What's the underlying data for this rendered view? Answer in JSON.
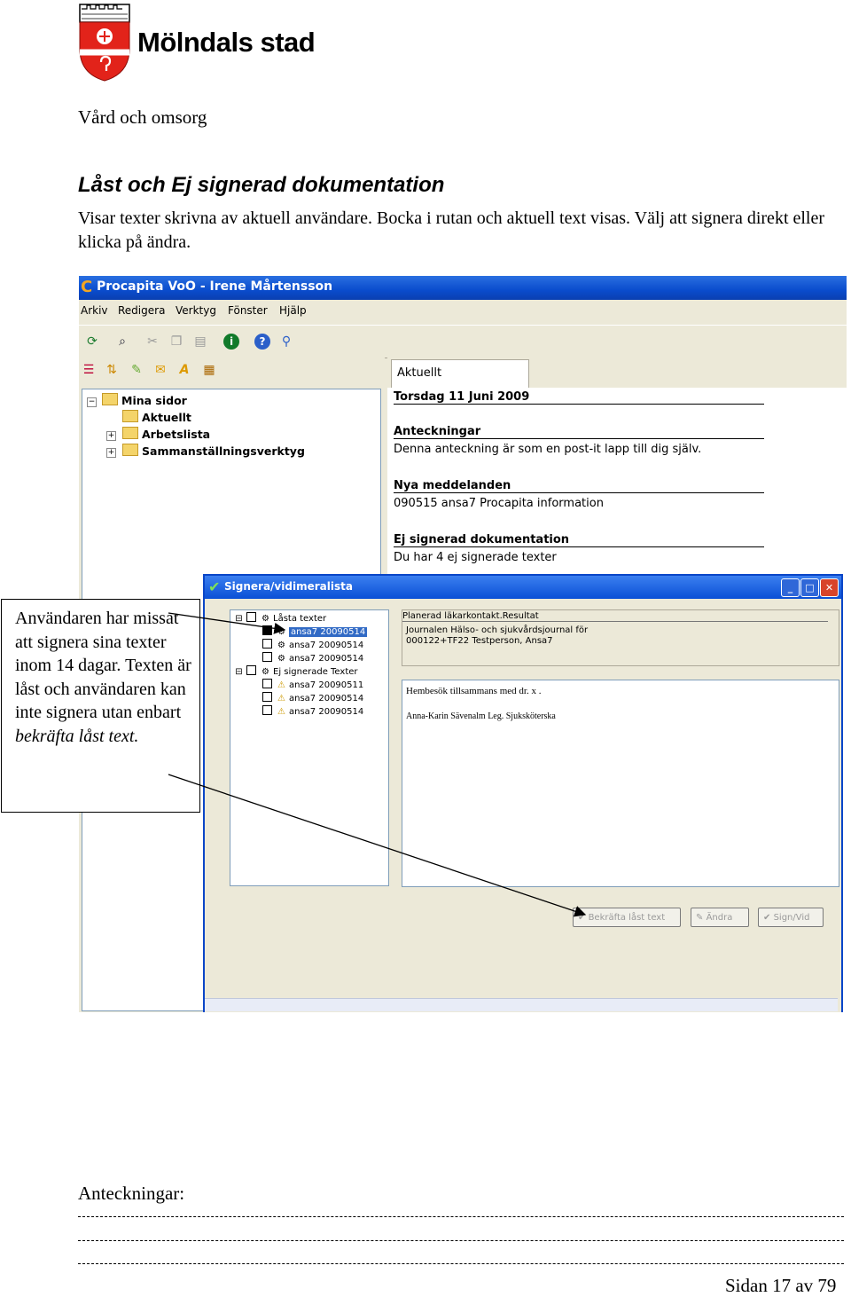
{
  "header": {
    "org_name": "Mölndals stad",
    "department": "Vård och omsorg"
  },
  "page": {
    "heading": "Låst och Ej signerad dokumentation",
    "intro": "Visar texter skrivna av aktuell användare. Bocka i rutan och aktuell text visas. Välj att signera direkt eller klicka på ändra.",
    "notes_label": "Anteckningar:",
    "page_number": "Sidan 17 av 79"
  },
  "screenshot": {
    "window_title": "Procapita VoO - Irene Mårtensson",
    "menu": [
      "Arkiv",
      "Redigera",
      "Verktyg",
      "Fönster",
      "Hjälp"
    ],
    "tree": {
      "root": "Mina sidor",
      "items": [
        "Aktuellt",
        "Arbetslista",
        "Sammanställningsverktyg"
      ]
    },
    "tab_label": "Aktuellt",
    "date": "Torsdag 11 Juni 2009",
    "sections": [
      {
        "title": "Anteckningar",
        "text": "Denna anteckning är som en post-it lapp till dig själv."
      },
      {
        "title": "Nya meddelanden",
        "text": "090515  ansa7  Procapita information"
      },
      {
        "title": "Ej signerad dokumentation",
        "text": "Du har 4 ej signerade texter"
      }
    ],
    "dialog": {
      "title": "Signera/vidimeralista",
      "locked_group": "Låsta texter",
      "locked_items": [
        "ansa7 20090514",
        "ansa7 20090514",
        "ansa7 20090514"
      ],
      "unsigned_group": "Ej signerade Texter",
      "unsigned_items": [
        "ansa7 20090511",
        "ansa7 20090514",
        "ansa7 20090514"
      ],
      "record_title": "Planerad läkarkontakt.Resultat",
      "record_line1": "Journalen Hälso- och sjukvårdsjournal för",
      "record_line2": "000122+TF22 Testperson, Ansa7",
      "body_line1": "Hembesök tillsammans med dr. x .",
      "body_line2": "Anna-Karin Sävenalm Leg. Sjuksköterska",
      "buttons": [
        "Bekräfta låst text",
        "Ändra",
        "Sign/Vid"
      ]
    }
  },
  "callout": {
    "text_plain": "Användaren har missat att signera sina texter inom 14 dagar. Texten är låst och användaren kan inte signera utan enbart",
    "text_italic": "bekräfta låst text."
  },
  "colors": {
    "titlebar": "#0a4ccd",
    "logo_red": "#e2231a"
  }
}
